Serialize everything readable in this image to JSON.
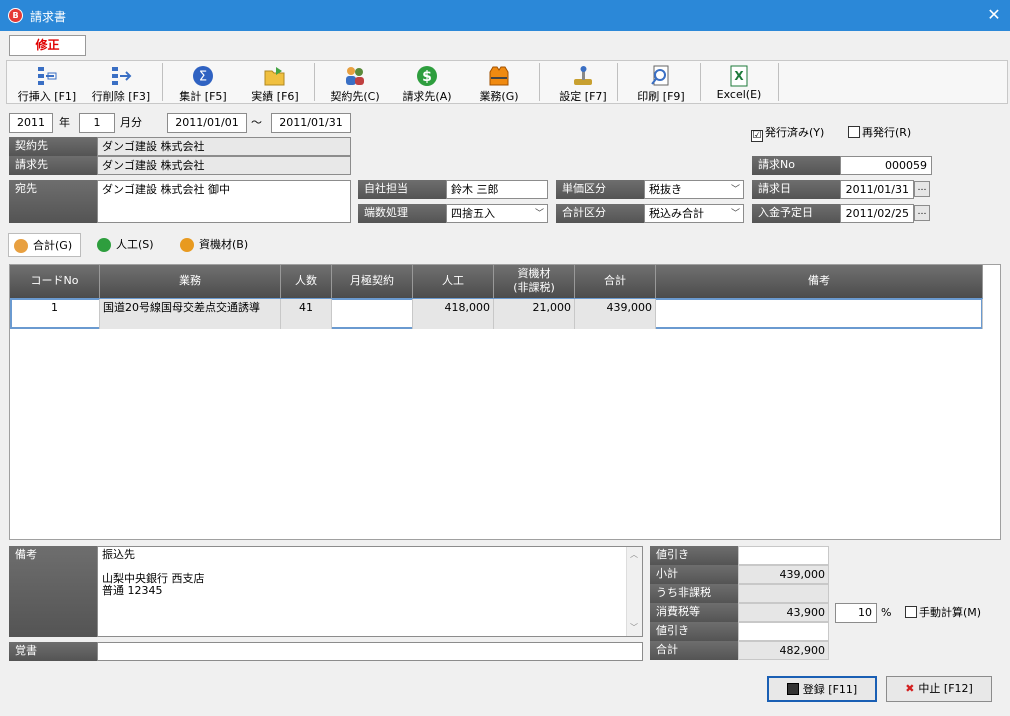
{
  "window": {
    "title": "請求書",
    "app_icon": "B"
  },
  "mode_label": "修正",
  "toolbar": [
    {
      "id": "row-insert",
      "label": "行挿入 [F1]",
      "icon": "row-insert-icon"
    },
    {
      "id": "row-delete",
      "label": "行削除 [F3]",
      "icon": "row-delete-icon"
    },
    {
      "id": "aggregate",
      "label": "集計 [F5]",
      "icon": "sigma-icon"
    },
    {
      "id": "actuals",
      "label": "実績 [F6]",
      "icon": "folder-icon"
    },
    {
      "id": "contract",
      "label": "契約先(C)",
      "icon": "people-icon"
    },
    {
      "id": "billto",
      "label": "請求先(A)",
      "icon": "dollar-icon"
    },
    {
      "id": "work",
      "label": "業務(G)",
      "icon": "vest-icon"
    },
    {
      "id": "settings",
      "label": "設定 [F7]",
      "icon": "joystick-icon"
    },
    {
      "id": "print",
      "label": "印刷 [F9]",
      "icon": "print-preview-icon"
    },
    {
      "id": "excel",
      "label": "Excel(E)",
      "icon": "excel-icon"
    }
  ],
  "period": {
    "year": "2011",
    "year_unit": "年",
    "month": "1",
    "month_unit": "月分",
    "from": "2011/01/01",
    "tilde": "～",
    "to": "2011/01/31"
  },
  "contract_label": "契約先",
  "contract_value": "ダンゴ建設 株式会社",
  "billto_label": "請求先",
  "billto_value": "ダンゴ建設 株式会社",
  "address_label": "宛先",
  "address_value": "ダンゴ建設 株式会社 御中",
  "staff_label": "自社担当",
  "staff_value": "鈴木 三郎",
  "rounding_label": "端数処理",
  "rounding_value": "四捨五入",
  "unit_label": "単価区分",
  "unit_value": "税抜き",
  "total_label": "合計区分",
  "total_value": "税込み合計",
  "issued": {
    "label": "発行済み(Y)",
    "checked": "☑"
  },
  "reissue": {
    "label": "再発行(R)",
    "checked": ""
  },
  "invoice_no_label": "請求No",
  "invoice_no_value": "000059",
  "invoice_date_label": "請求日",
  "invoice_date_value": "2011/01/31",
  "payment_date_label": "入金予定日",
  "payment_date_value": "2011/02/25",
  "dots": "…",
  "tabs": [
    {
      "label": "合計(G)",
      "icon": "people-icon"
    },
    {
      "label": "人工(S)",
      "icon": "dollar-icon"
    },
    {
      "label": "資機材(B)",
      "icon": "coin-icon"
    }
  ],
  "grid": {
    "headers": [
      "コードNo",
      "業務",
      "人数",
      "月極契約",
      "人工",
      "資機材\n(非課税)",
      "合計",
      "備考"
    ],
    "rows": [
      {
        "code": "1",
        "work": "国道20号線国母交差点交通誘導",
        "people": "41",
        "monthly": "",
        "labor": "418,000",
        "materials": "21,000",
        "total": "439,000",
        "note": ""
      }
    ]
  },
  "remarks_label": "備考",
  "remarks_lines": [
    "振込先",
    "",
    "山梨中央銀行 西支店",
    "普通 12345"
  ],
  "memo_label": "覚書",
  "memo_value": "",
  "summary": [
    {
      "label": "値引き",
      "value": ""
    },
    {
      "label": "小計",
      "value": "439,000"
    },
    {
      "label": "うち非課税",
      "value": ""
    },
    {
      "label": "消費税等",
      "value": "43,900"
    },
    {
      "label": "値引き",
      "value": ""
    },
    {
      "label": "合計",
      "value": "482,900"
    }
  ],
  "tax_rate": "10",
  "percent": "%",
  "manual_calc": {
    "label": "手動計算(M)",
    "checked": ""
  },
  "buttons": {
    "register": "登録 [F11]",
    "cancel": "中止 [F12]"
  },
  "colors": {
    "titlebar": "#2b88d8",
    "mode_text": "#e00000",
    "label_bg": "#5e5e5e"
  }
}
